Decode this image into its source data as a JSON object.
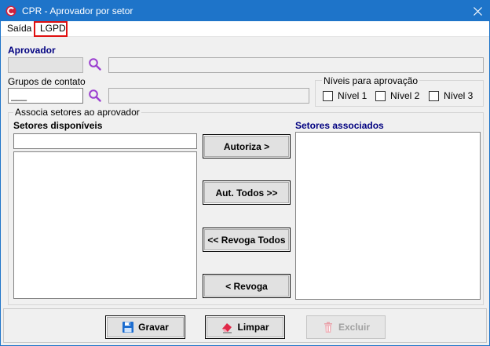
{
  "window": {
    "title": "CPR - Aprovador por setor",
    "app_icon": "cpr-logo-icon",
    "close_icon": "close-icon"
  },
  "menu": {
    "saida": "Saída",
    "lgpd": "LGPD"
  },
  "aprovador": {
    "label": "Aprovador",
    "code_value": "",
    "name_value": ""
  },
  "grupos": {
    "label": "Grupos de contato",
    "code_value": "___",
    "name_value": ""
  },
  "niveis": {
    "legend": "Níveis para aprovação",
    "options": [
      {
        "label": "Nível 1",
        "checked": false
      },
      {
        "label": "Nível 2",
        "checked": false
      },
      {
        "label": "Nível 3",
        "checked": false
      }
    ]
  },
  "associa": {
    "legend": "Associa setores ao aprovador",
    "disponiveis_label": "Setores disponíveis",
    "associados_label": "Setores associados",
    "filter_value": ""
  },
  "actions": {
    "autoriza": "Autoriza >",
    "aut_todos": "Aut. Todos >>",
    "revoga_todos": "<< Revoga Todos",
    "revoga": "< Revoga"
  },
  "footer": {
    "gravar": "Gravar",
    "limpar": "Limpar",
    "excluir": "Excluir"
  },
  "colors": {
    "titlebar": "#1e74c9",
    "section_label": "#000080",
    "highlight": "#e01010",
    "search_icon": "#9b3fd0"
  }
}
